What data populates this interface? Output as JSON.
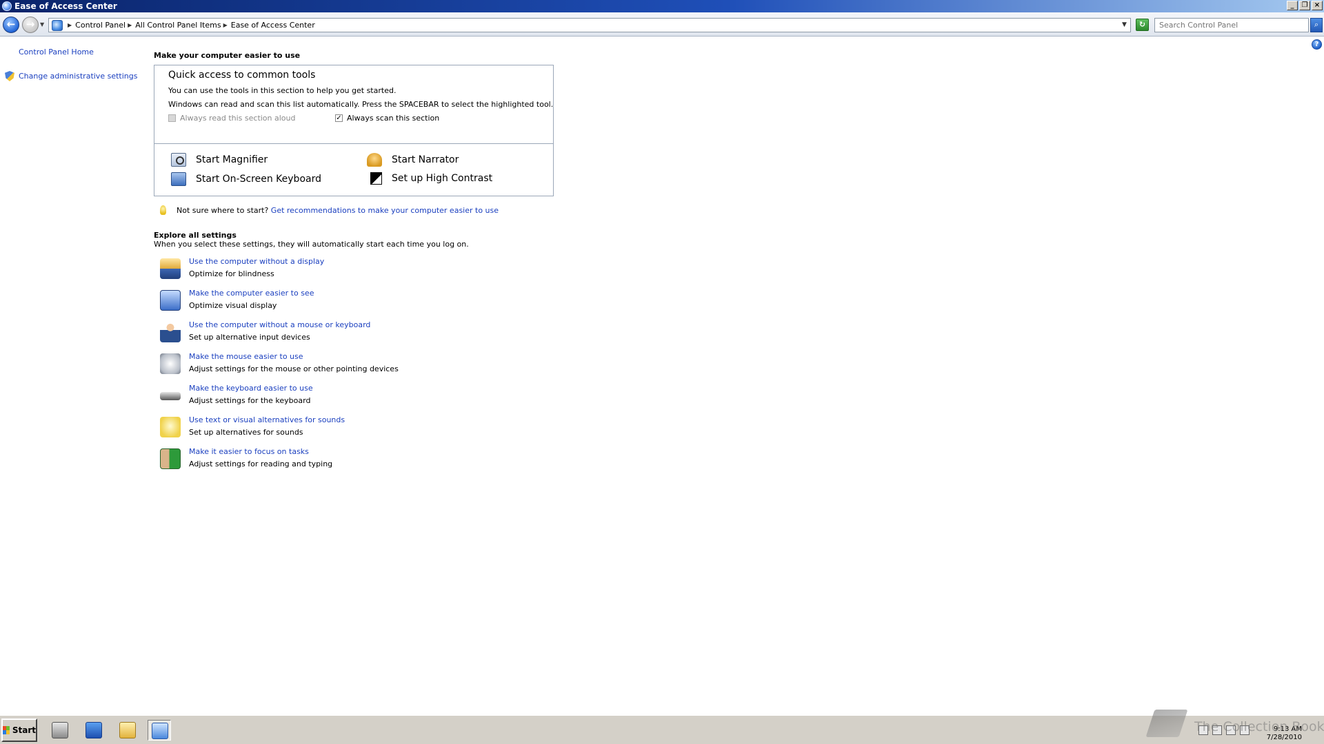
{
  "window": {
    "title": "Ease of Access Center"
  },
  "address": {
    "breadcrumbs": [
      "Control Panel",
      "All Control Panel Items",
      "Ease of Access Center"
    ],
    "search_placeholder": "Search Control Panel"
  },
  "left_pane": {
    "home": "Control Panel Home",
    "admin": "Change administrative settings"
  },
  "main": {
    "heading": "Make your computer easier to use",
    "quick_access": {
      "title": "Quick access to common tools",
      "line1": "You can use the tools in this section to help you get started.",
      "line2": "Windows can read and scan this list automatically.  Press the SPACEBAR to select the highlighted tool.",
      "read_aloud": "Always read this section aloud",
      "scan": "Always scan this section",
      "scan_checked": "✓",
      "tools": {
        "magnifier": "Start Magnifier",
        "narrator": "Start Narrator",
        "keyboard": "Start On-Screen Keyboard",
        "contrast": "Set up High Contrast"
      }
    },
    "tip": {
      "prefix": "Not sure where to start?",
      "link": "Get recommendations to make your computer easier to use"
    },
    "explore": {
      "title": "Explore all settings",
      "desc": "When you select these settings, they will automatically start each time you log on.",
      "items": [
        {
          "link": "Use the computer without a display",
          "desc": "Optimize for blindness"
        },
        {
          "link": "Make the computer easier to see",
          "desc": "Optimize visual display"
        },
        {
          "link": "Use the computer without a mouse or keyboard",
          "desc": "Set up alternative input devices"
        },
        {
          "link": "Make the mouse easier to use",
          "desc": "Adjust settings for the mouse or other pointing devices"
        },
        {
          "link": "Make the keyboard easier to use",
          "desc": "Adjust settings for the keyboard"
        },
        {
          "link": "Use text or visual alternatives for sounds",
          "desc": "Set up alternatives for sounds"
        },
        {
          "link": "Make it easier to focus on tasks",
          "desc": "Adjust settings for reading and typing"
        }
      ]
    }
  },
  "taskbar": {
    "start": "Start",
    "time": "9:13 AM",
    "date": "7/28/2010"
  },
  "watermark": "The Collection Book"
}
